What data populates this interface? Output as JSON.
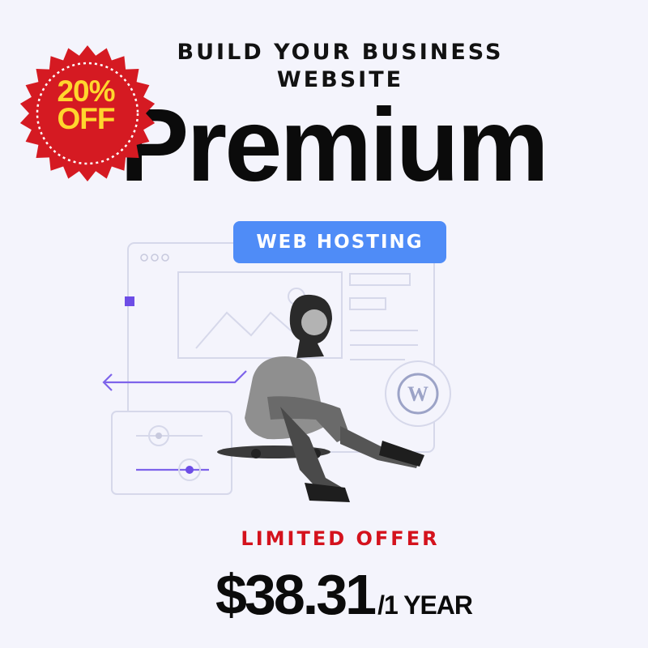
{
  "headline": {
    "line1": "BUILD YOUR BUSINESS",
    "line2": "WEBSITE"
  },
  "product_name": "Premium",
  "badge": {
    "line1": "20%",
    "line2": "OFF"
  },
  "category_label": "WEB HOSTING",
  "offer_label": "LIMITED OFFER",
  "price": {
    "amount": "$38.31",
    "period": "/1 YEAR"
  },
  "colors": {
    "background": "#f4f4fc",
    "badge_red": "#d51a22",
    "badge_text": "#ffd62e",
    "pill_blue": "#4f8cf7",
    "offer_red": "#d4121d",
    "accent_purple": "#6d4de6"
  },
  "icons": {
    "badge_shape": "starburst-icon",
    "logo": "wordpress-icon",
    "image_placeholder": "mountain-image-icon",
    "arrow": "arrow-left-icon"
  }
}
